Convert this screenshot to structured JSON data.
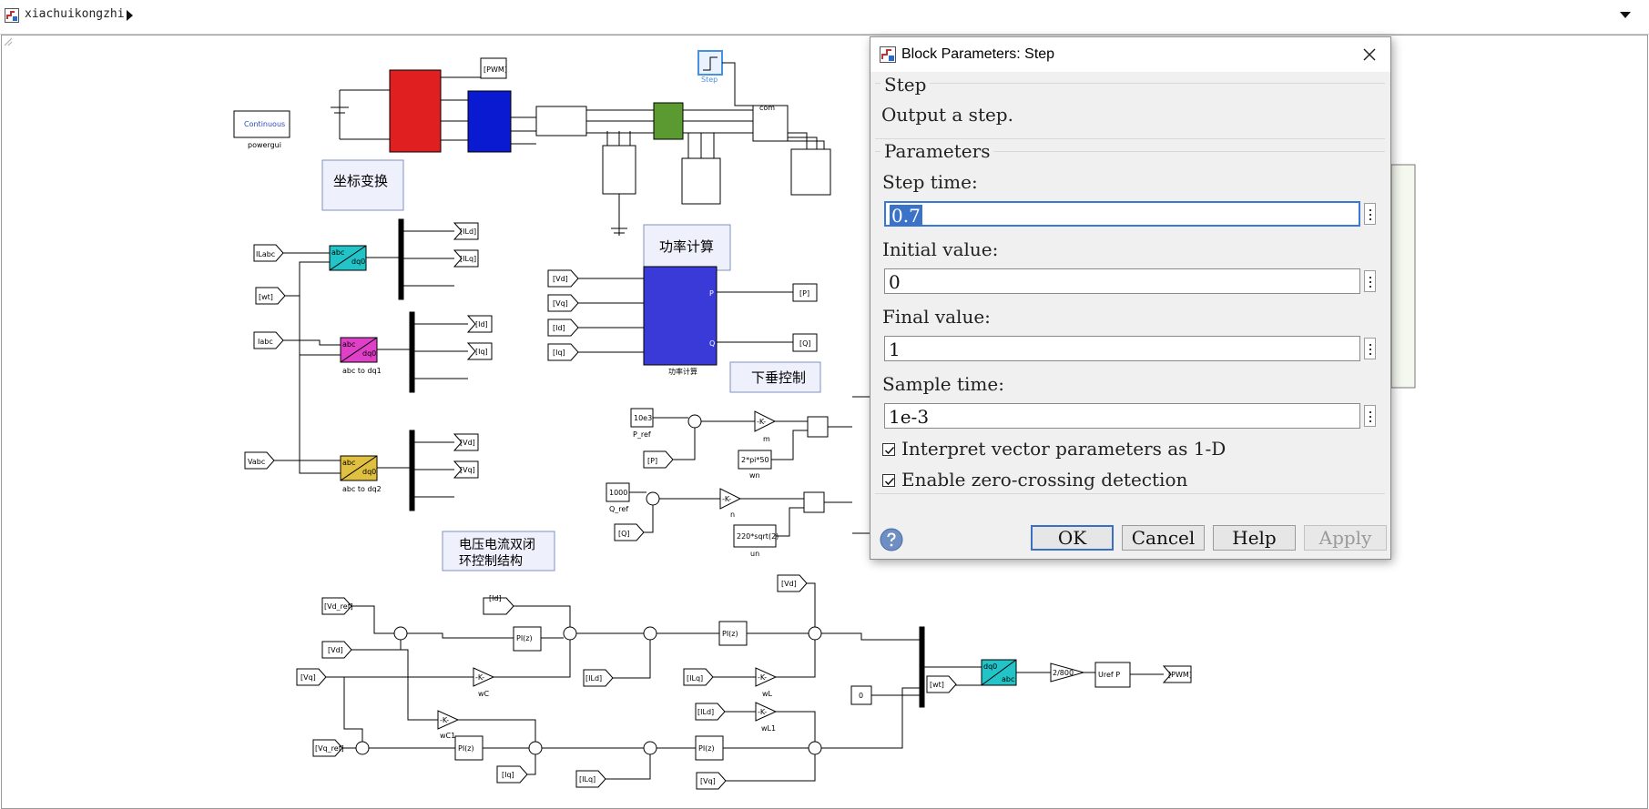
{
  "app": {
    "model_name": "xiachuikongzhi"
  },
  "diagram": {
    "powergui": {
      "mode": "Continuous",
      "label": "powergui"
    },
    "annotations": {
      "coord": "坐标变换",
      "power": "功率计算",
      "droop": "下垂控制",
      "loop_line1": "电压电流双闭",
      "loop_line2": "环控制结构"
    },
    "step_block_label": "Step",
    "gotos": {
      "pwm_top": "[PWM]",
      "ild": "[ILd]",
      "ilq": "[ILq]",
      "id": "[Id]",
      "iq": "[Iq]",
      "vd": "[Vd]",
      "vq": "[Vq]",
      "p": "[P]",
      "q": "[Q]",
      "pwm_out": "[PWM]"
    },
    "froms": {
      "ilabc": "ILabc",
      "wt": "[wt]",
      "iabc": "Iabc",
      "vabc": "Vabc",
      "vd": "[Vd]",
      "vq": "[Vq]",
      "id": "[Id]",
      "iq": "[Iq]",
      "p": "[P]",
      "q": "[Q]",
      "vd_ref": "[Vd_ref]",
      "vq_ref": "[Vq_ref]",
      "vd2": "[Vd]",
      "vq2": "[Vq]",
      "id2": "[Id]",
      "iq2": "[Iq]",
      "ild": "[ILd]",
      "ilq": "[ILq]",
      "ild2": "[ILd]",
      "ilq2": "[ILq]",
      "vd3": "[Vd]",
      "vq3": "[Vq]",
      "wt2": "[wt]"
    },
    "blocks": {
      "abc": "abc",
      "dq0": "dq0",
      "abc_to_dq1": "abc to dq1",
      "abc_to_dq2": "abc to dq2",
      "power_calc": "功率计算",
      "p_ref_val": "10e3",
      "p_ref": "P_ref",
      "q_ref_val": "1000",
      "q_ref": "Q_ref",
      "gain_k": "-K-",
      "m": "m",
      "n": "n",
      "wn_val": "2*pi*50",
      "wn": "wn",
      "un_val": "220*sqrt(2)",
      "un": "un",
      "pi": "PI(z)",
      "wc": "wC",
      "wc1": "wC1",
      "wl": "wL",
      "wl1": "wL1",
      "zero": "0",
      "gain_800": "2/800",
      "uref": "Uref  P",
      "P": "P",
      "Q": "Q",
      "com": "com"
    }
  },
  "dialog": {
    "title": "Block Parameters: Step",
    "group_title": "Step",
    "description": "Output a step.",
    "params_title": "Parameters",
    "fields": [
      {
        "label": "Step time:",
        "value": "0.7"
      },
      {
        "label": "Initial value:",
        "value": "0"
      },
      {
        "label": "Final value:",
        "value": "1"
      },
      {
        "label": "Sample time:",
        "value": "1e-3"
      }
    ],
    "checkboxes": [
      {
        "label": "Interpret vector parameters as 1-D",
        "checked": true
      },
      {
        "label": "Enable zero-crossing detection",
        "checked": true
      }
    ],
    "buttons": {
      "ok": "OK",
      "cancel": "Cancel",
      "help": "Help",
      "apply": "Apply"
    }
  },
  "colors": {
    "inverter": "#e02020",
    "filter": "#0a1ad0",
    "breaker": "#5a9a30",
    "dq_cyan": "#22c4c8",
    "dq_magenta": "#e040c8",
    "dq_yellow": "#e0c040",
    "power_block": "#3a3ad8",
    "selection": "#3a73c8"
  }
}
